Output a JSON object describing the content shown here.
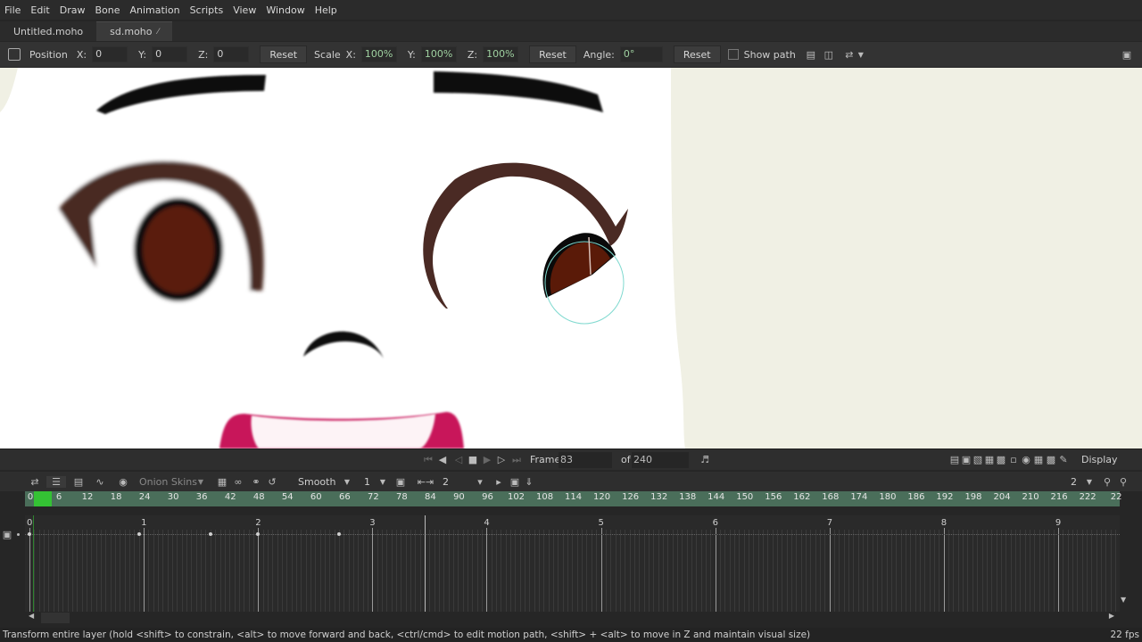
{
  "menu": [
    "File",
    "Edit",
    "Draw",
    "Bone",
    "Animation",
    "Scripts",
    "View",
    "Window",
    "Help"
  ],
  "tabs": [
    {
      "label": "Untitled.moho",
      "active": false
    },
    {
      "label": "sd.moho",
      "active": true,
      "modified": "⁄"
    }
  ],
  "tool_options": {
    "position_label": "Position",
    "px_label": "X:",
    "px": "0",
    "py_label": "Y:",
    "py": "0",
    "pz_label": "Z:",
    "pz": "0",
    "reset1": "Reset",
    "scale_label": "Scale",
    "sx_label": "X:",
    "sx": "100%",
    "sy_label": "Y:",
    "sy": "100%",
    "sz_label": "Z:",
    "sz": "100%",
    "reset2": "Reset",
    "angle_label": "Angle:",
    "angle": "0°",
    "reset3": "Reset",
    "show_path": "Show path"
  },
  "playback": {
    "frame_label": "Frame",
    "frame": "83",
    "of_label": "of",
    "total": "240",
    "display": "Display"
  },
  "timeline": {
    "onion_skins": "Onion Skins",
    "interp": "Smooth",
    "interp_num": "1",
    "ease_num": "2",
    "zoom_num": "2",
    "ruler_ticks": [
      "0",
      "6",
      "12",
      "18",
      "24",
      "30",
      "36",
      "42",
      "48",
      "54",
      "60",
      "66",
      "72",
      "78",
      "84",
      "90",
      "96",
      "102",
      "108",
      "114",
      "120",
      "126",
      "132",
      "138",
      "144",
      "150",
      "156",
      "162",
      "168",
      "174",
      "180",
      "186",
      "192",
      "198",
      "204",
      "210",
      "216",
      "222",
      "22"
    ],
    "seconds": [
      "0",
      "1",
      "2",
      "3",
      "4",
      "5",
      "6",
      "7",
      "8",
      "9"
    ]
  },
  "status": {
    "hint": "Transform entire layer (hold <shift> to constrain, <alt> to move forward and back, <ctrl/cmd> to edit motion path, <shift> + <alt> to move in Z and maintain visual size)",
    "fps": "22 fps"
  },
  "colors": {
    "ruler": "#4a6e5a",
    "playhead": "#34c234",
    "pupil": "#5a1a08",
    "brow": "#4a2a24",
    "mouth": "#c8185a"
  }
}
